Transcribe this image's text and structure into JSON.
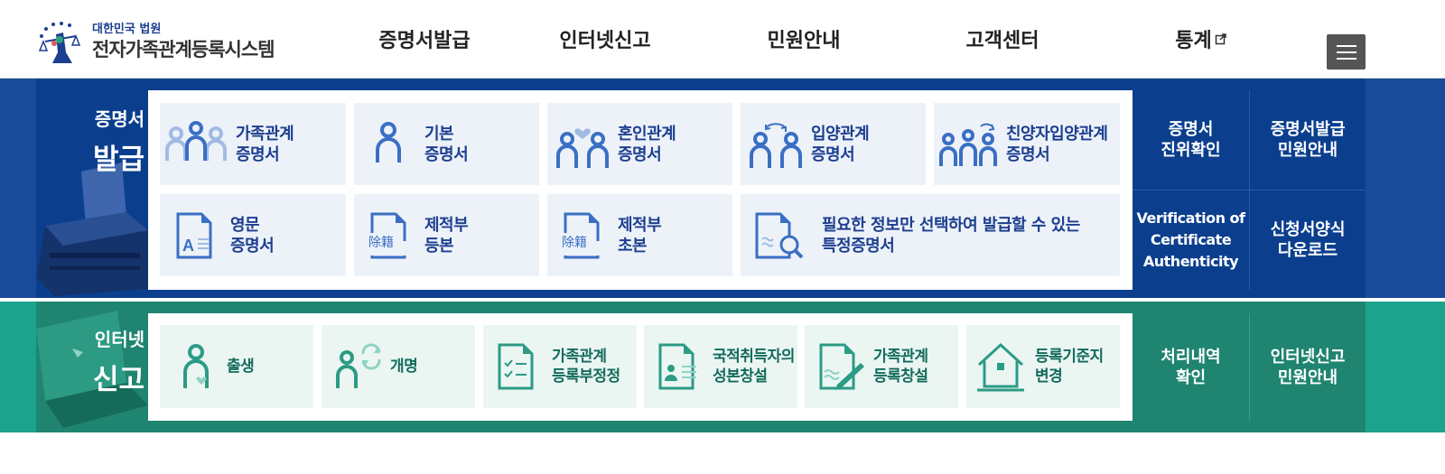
{
  "header": {
    "logo_sub": "대한민국 법원",
    "logo_title": "전자가족관계등록시스템",
    "nav": [
      "증명서발급",
      "인터넷신고",
      "민원안내",
      "고객센터",
      "통계"
    ],
    "menu_icon": "hamburger-icon"
  },
  "cert_section": {
    "title_line1": "증명서",
    "title_line2": "발급",
    "cards": [
      {
        "line1": "가족관계",
        "line2": "증명서",
        "icon": "family-icon"
      },
      {
        "line1": "기본",
        "line2": "증명서",
        "icon": "person-icon"
      },
      {
        "line1": "혼인관계",
        "line2": "증명서",
        "icon": "couple-heart-icon"
      },
      {
        "line1": "입양관계",
        "line2": "증명서",
        "icon": "adoption-icon"
      },
      {
        "line1": "친양자입양관계",
        "line2": "증명서",
        "icon": "full-adoption-icon"
      },
      {
        "line1": "영문",
        "line2": "증명서",
        "icon": "english-document-icon"
      },
      {
        "line1": "제적부",
        "line2": "등본",
        "icon": "removed-register-document-icon"
      },
      {
        "line1": "제적부",
        "line2": "초본",
        "icon": "removed-register-document-icon"
      },
      {
        "line1": "필요한 정보만 선택하여 발급할 수 있는",
        "line2": "특정증명서",
        "icon": "document-search-icon"
      }
    ],
    "side": [
      {
        "line1": "증명서",
        "line2": "진위확인"
      },
      {
        "line1": "증명서발급",
        "line2": "민원안내"
      },
      {
        "line1": "Verification of",
        "line2": "Certificate",
        "line3": "Authenticity"
      },
      {
        "line1": "신청서양식",
        "line2": "다운로드"
      }
    ],
    "deco_label": "除籍"
  },
  "net_section": {
    "title_line1": "인터넷",
    "title_line2": "신고",
    "cards": [
      {
        "line1": "출생",
        "line2": "",
        "icon": "birth-icon"
      },
      {
        "line1": "개명",
        "line2": "",
        "icon": "rename-icon"
      },
      {
        "line1": "가족관계",
        "line2": "등록부정정",
        "icon": "checklist-document-icon"
      },
      {
        "line1": "국적취득자의",
        "line2": "성본창설",
        "icon": "id-card-document-icon"
      },
      {
        "line1": "가족관계",
        "line2": "등록창설",
        "icon": "document-pen-icon"
      },
      {
        "line1": "등록기준지",
        "line2": "변경",
        "icon": "house-icon"
      }
    ],
    "side": [
      {
        "line1": "처리내역",
        "line2": "확인"
      },
      {
        "line1": "인터넷신고",
        "line2": "민원안내"
      }
    ]
  },
  "colors": {
    "cert_band": "#0b3f8e",
    "net_band": "#1f8470",
    "cert_text": "#1d3f8f",
    "net_text": "#136b5b",
    "icon_blue": "#3a6fc4",
    "icon_green": "#2c9b84"
  }
}
